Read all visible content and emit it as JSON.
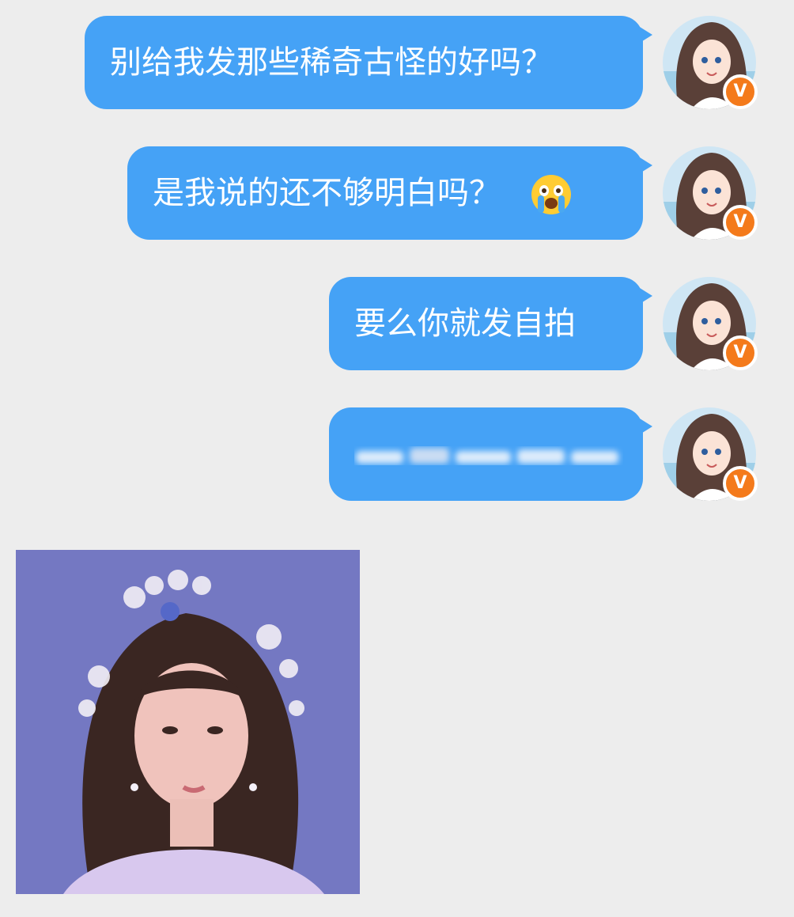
{
  "messages": [
    {
      "text": "别给我发那些稀奇古怪的好吗？",
      "sender": "me"
    },
    {
      "text": "是我说的还不够明白吗？",
      "emoji": "crying-face-icon",
      "sender": "me"
    },
    {
      "text": "要么你就发自拍",
      "sender": "me"
    },
    {
      "text": "",
      "blurred": true,
      "sender": "me"
    }
  ],
  "avatar": {
    "badge": "V",
    "badge_color": "#f47a1b"
  },
  "colors": {
    "bubble": "#45a2f6",
    "background": "#ededed"
  },
  "photo": {
    "icon": "selfie-photo-image"
  }
}
